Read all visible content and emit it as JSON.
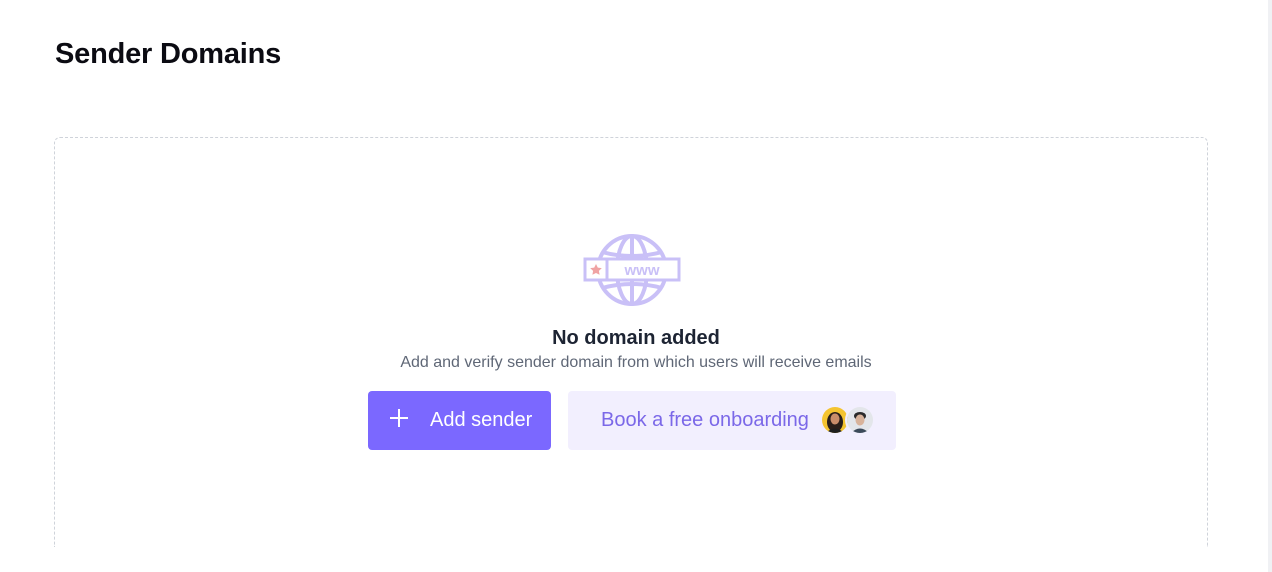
{
  "page": {
    "title": "Sender Domains"
  },
  "empty_state": {
    "illustration_icon": "globe-www-icon",
    "illustration_text": "www",
    "title": "No domain added",
    "description": "Add and verify sender domain from which users will receive emails"
  },
  "actions": {
    "add_sender": {
      "label": "Add sender",
      "icon": "plus-icon"
    },
    "book_onboarding": {
      "label": "Book a free onboarding",
      "avatars": [
        "avatar-woman",
        "avatar-man"
      ]
    }
  },
  "colors": {
    "accent": "#7b68ff",
    "accent_light": "#f2effe",
    "accent_text": "#7b68e8",
    "illustration": "#c9c0f7",
    "title_text": "#0b0b12",
    "muted_text": "#5f6776",
    "star": "#f0a3a3"
  }
}
